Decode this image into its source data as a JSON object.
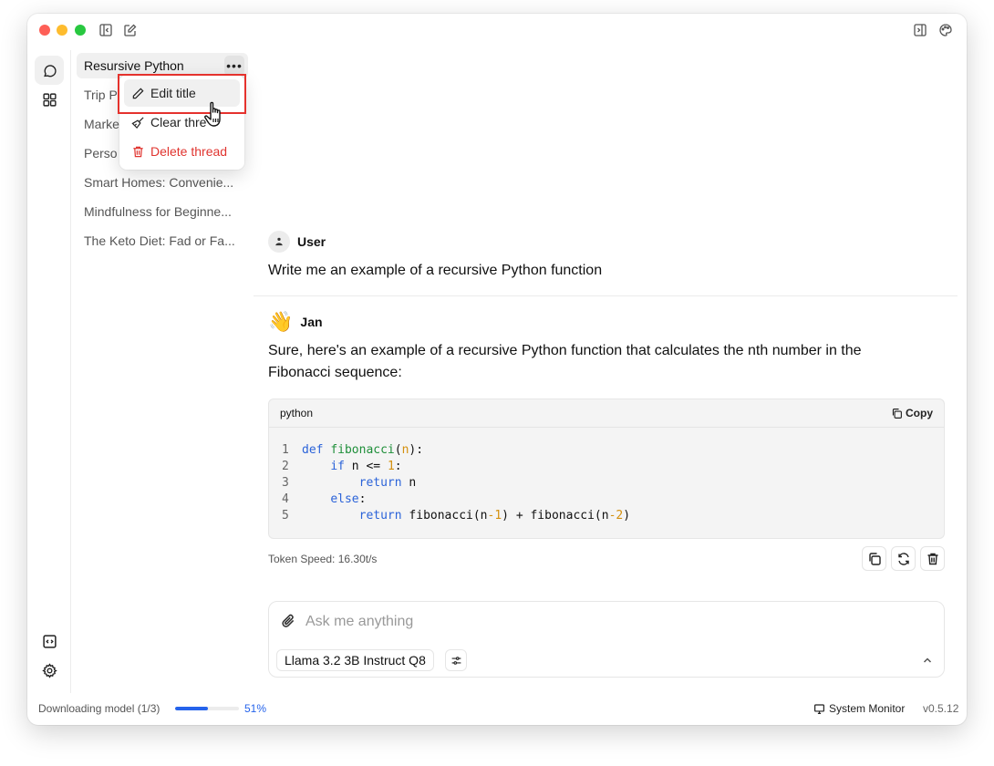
{
  "titlebar": {
    "left_icons": [
      "sidebar-collapse-icon",
      "new-thread-icon"
    ],
    "right_icons": [
      "right-panel-icon",
      "palette-icon"
    ]
  },
  "rail": {
    "top": [
      {
        "icon": "chat-icon",
        "active": true
      },
      {
        "icon": "grid-icon",
        "active": false
      }
    ],
    "bottom": [
      {
        "icon": "code-icon"
      },
      {
        "icon": "gear-icon"
      }
    ]
  },
  "threads": [
    {
      "title": "Resursive Python",
      "active": true
    },
    {
      "title": "Trip P",
      "active": false
    },
    {
      "title": "Marke",
      "active": false
    },
    {
      "title": "Perso",
      "active": false
    },
    {
      "title": "Smart Homes: Convenie...",
      "active": false
    },
    {
      "title": "Mindfulness for Beginne...",
      "active": false
    },
    {
      "title": "The Keto Diet: Fad or Fa...",
      "active": false
    }
  ],
  "thread_menu": {
    "more_label": "•••",
    "items": [
      {
        "label": "Edit title",
        "icon": "pencil-icon"
      },
      {
        "label": "Clear thread",
        "visible_label": "Clear thre",
        "icon": "broom-icon"
      },
      {
        "label": "Delete thread",
        "icon": "trash-icon",
        "danger": true
      }
    ]
  },
  "conversation": {
    "user": {
      "name": "User",
      "text": "Write me an example of a recursive Python function"
    },
    "assistant": {
      "name": "Jan",
      "emoji": "👋",
      "text": "Sure, here's an example of a recursive Python function that calculates the nth number in the Fibonacci sequence:",
      "code": {
        "language": "python",
        "copy_label": "Copy",
        "lines": [
          "def fibonacci(n):",
          "    if n <= 1:",
          "        return n",
          "    else:",
          "        return fibonacci(n-1) + fibonacci(n-2)"
        ]
      },
      "token_speed": "Token Speed: 16.30t/s"
    }
  },
  "composer": {
    "placeholder": "Ask me anything",
    "value": "",
    "model": "Llama 3.2 3B Instruct Q8"
  },
  "statusbar": {
    "download_text": "Downloading model (1/3)",
    "progress_percent": 51,
    "progress_label": "51%",
    "system_monitor": "System Monitor",
    "version": "v0.5.12"
  },
  "colors": {
    "accent": "#2563eb",
    "danger": "#e0342f",
    "highlight_box": "#e5322d"
  }
}
